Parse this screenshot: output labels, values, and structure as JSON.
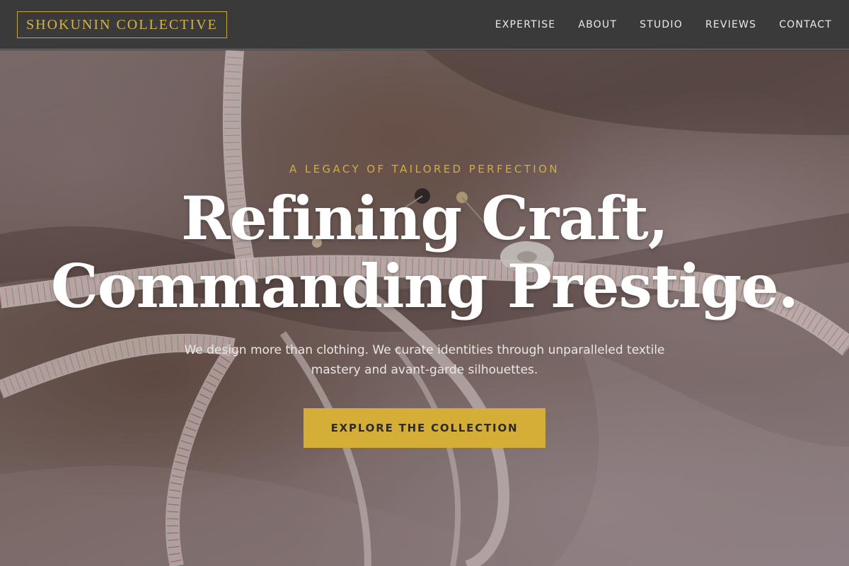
{
  "header": {
    "logo": "SHOKUNIN COLLECTIVE",
    "nav": [
      {
        "label": "EXPERTISE"
      },
      {
        "label": "ABOUT"
      },
      {
        "label": "STUDIO"
      },
      {
        "label": "REVIEWS"
      },
      {
        "label": "CONTACT"
      }
    ]
  },
  "hero": {
    "eyebrow": "A LEGACY OF TAILORED PERFECTION",
    "headline_line1": "Refining Craft,",
    "headline_line2": "Commanding Prestige.",
    "subtitle": "We design more than clothing. We curate identities through unparalleled textile mastery and avant-garde silhouettes.",
    "cta_label": "EXPLORE THE COLLECTION",
    "background_image": "tailoring-fabric-measuring-tape-photo"
  },
  "colors": {
    "accent": "#d4ae37",
    "header_bg": "#3a3a3a",
    "nav_text": "#ececec",
    "headline_text": "#ffffff"
  }
}
